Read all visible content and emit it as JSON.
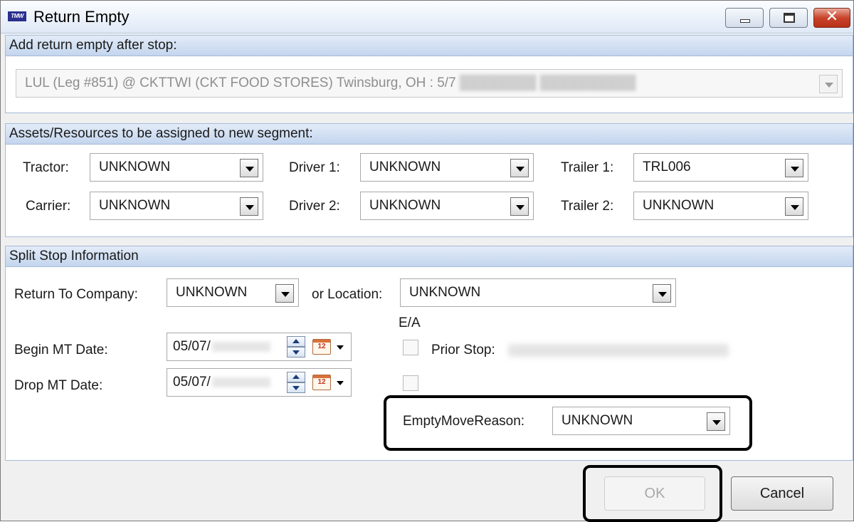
{
  "window": {
    "app_icon_text": "TMW",
    "title": "Return Empty",
    "minimize": "minimize",
    "maximize": "maximize",
    "close": "✕"
  },
  "add_after": {
    "header": "Add return empty after stop:",
    "stop_value": "LUL (Leg #851) @ CKTTWI (CKT FOOD STORES) Twinsburg, OH : 5/7"
  },
  "assets": {
    "header": "Assets/Resources to be assigned to new segment:",
    "tractor_label": "Tractor:",
    "tractor_value": "UNKNOWN",
    "carrier_label": "Carrier:",
    "carrier_value": "UNKNOWN",
    "driver1_label": "Driver 1:",
    "driver1_value": "UNKNOWN",
    "driver2_label": "Driver 2:",
    "driver2_value": "UNKNOWN",
    "trailer1_label": "Trailer 1:",
    "trailer1_value": "TRL006",
    "trailer2_label": "Trailer 2:",
    "trailer2_value": "UNKNOWN"
  },
  "split": {
    "header": "Split Stop Information",
    "return_company_label": "Return To Company:",
    "return_company_value": "UNKNOWN",
    "location_label": "or Location:",
    "location_value": "UNKNOWN",
    "ea_label": "E/A",
    "begin_label": "Begin MT Date:",
    "begin_value": "05/07/",
    "drop_label": "Drop MT Date:",
    "drop_value": "05/07/",
    "calendar_day": "12",
    "prior_stop_label": "Prior Stop:",
    "empty_reason_label": "EmptyMoveReason:",
    "empty_reason_value": "UNKNOWN"
  },
  "buttons": {
    "ok": "OK",
    "cancel": "Cancel"
  }
}
